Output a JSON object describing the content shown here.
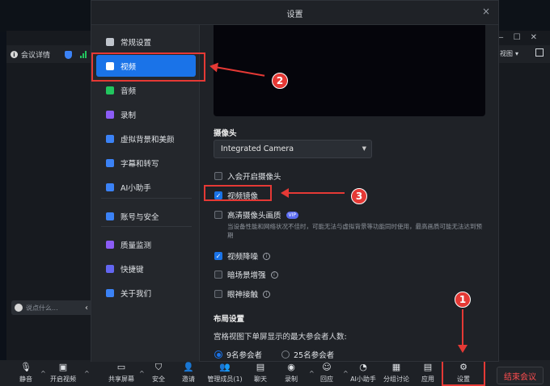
{
  "meeting": {
    "info_label": "会议详情",
    "view_label": "视图",
    "chat_placeholder": "说点什么..."
  },
  "modal": {
    "title": "设置",
    "close_label": "×",
    "nav": [
      {
        "label": "常规设置",
        "icon": "gear-icon",
        "color": "#bfc4cc"
      },
      {
        "label": "视频",
        "icon": "camera-icon",
        "color": "#ffffff"
      },
      {
        "label": "音频",
        "icon": "speaker-icon",
        "color": "#22c55e"
      },
      {
        "label": "录制",
        "icon": "record-icon",
        "color": "#8b5cf6"
      },
      {
        "label": "虚拟背景和美颜",
        "icon": "portrait-icon",
        "color": "#3b82f6"
      },
      {
        "label": "字幕和转写",
        "icon": "subtitle-icon",
        "color": "#3b82f6"
      },
      {
        "label": "AI小助手",
        "icon": "ai-icon",
        "color": "#3b82f6"
      },
      {
        "label": "账号与安全",
        "icon": "account-icon",
        "color": "#3b82f6"
      },
      {
        "label": "质量监测",
        "icon": "monitor-icon",
        "color": "#8b5cf6"
      },
      {
        "label": "快捷键",
        "icon": "keyboard-icon",
        "color": "#6366f1"
      },
      {
        "label": "关于我们",
        "icon": "about-icon",
        "color": "#3b82f6"
      }
    ],
    "camera": {
      "section_title": "摄像头",
      "selected_camera": "Integrated Camera",
      "options": [
        {
          "label": "入会开启摄像头",
          "checked": false
        },
        {
          "label": "视频镜像",
          "checked": true
        },
        {
          "label": "高清摄像头画质",
          "checked": false,
          "badge": "VIP"
        },
        {
          "label": "视频降噪",
          "checked": true,
          "info": true
        },
        {
          "label": "暗场景增强",
          "checked": false,
          "info": true
        },
        {
          "label": "眼神接触",
          "checked": false,
          "info": true
        }
      ],
      "hd_hint": "当设备性能和网络状况不佳时，可能无法与虚拟背景等功能同时使用，最高画质可能无法达到预期"
    },
    "layout": {
      "section_title": "布局设置",
      "max_text": "宫格视图下单屏显示的最大参会者人数:",
      "options": [
        {
          "label": "9名参会者",
          "selected": true
        },
        {
          "label": "25名参会者",
          "selected": false
        }
      ]
    }
  },
  "toolbar": {
    "items": [
      {
        "label": "静音",
        "icon": "mic-icon"
      },
      {
        "label": "开启视频",
        "icon": "video-off-icon"
      },
      {
        "label": "共享屏幕",
        "icon": "share-screen-icon"
      },
      {
        "label": "安全",
        "icon": "shield-icon"
      },
      {
        "label": "邀请",
        "icon": "invite-icon"
      },
      {
        "label": "管理成员(1)",
        "icon": "members-icon"
      },
      {
        "label": "聊天",
        "icon": "chat-icon"
      },
      {
        "label": "录制",
        "icon": "record-icon"
      },
      {
        "label": "回应",
        "icon": "reaction-icon"
      },
      {
        "label": "AI小助手",
        "icon": "ai-icon"
      },
      {
        "label": "分组讨论",
        "icon": "breakout-icon"
      },
      {
        "label": "应用",
        "icon": "apps-icon"
      },
      {
        "label": "设置",
        "icon": "gear-icon"
      }
    ],
    "end_label": "结束会议"
  },
  "annotations": {
    "badge_1": "1",
    "badge_2": "2",
    "badge_3": "3",
    "highlight_color": "#e53935"
  }
}
